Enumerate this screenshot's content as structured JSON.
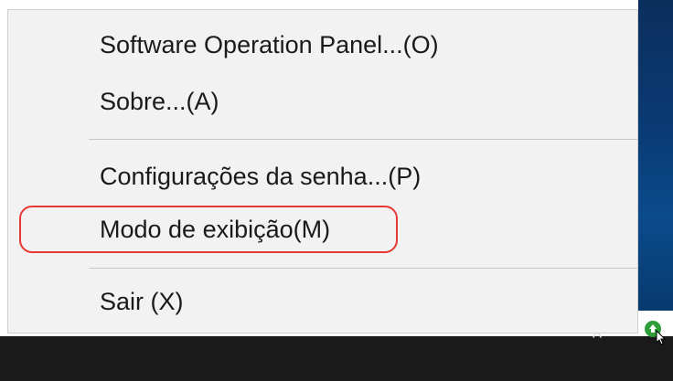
{
  "context_menu": {
    "items": [
      {
        "label": "Software Operation Panel...(O)"
      },
      {
        "label": "Sobre...(A)"
      },
      {
        "label": "Configurações da senha...(P)"
      },
      {
        "label": "Modo de exibição(M)"
      },
      {
        "label": "Sair (X)"
      }
    ],
    "highlighted_item": "Modo de exibição(M)",
    "highlight_color": "#e53935"
  },
  "taskbar": {
    "tray_icons": [
      "chevron-up-icon",
      "scanner-app-icon"
    ]
  },
  "colors": {
    "menu_background": "#f2f2f2",
    "taskbar": "#1a1a1a",
    "desktop": "#0b3a6e"
  }
}
